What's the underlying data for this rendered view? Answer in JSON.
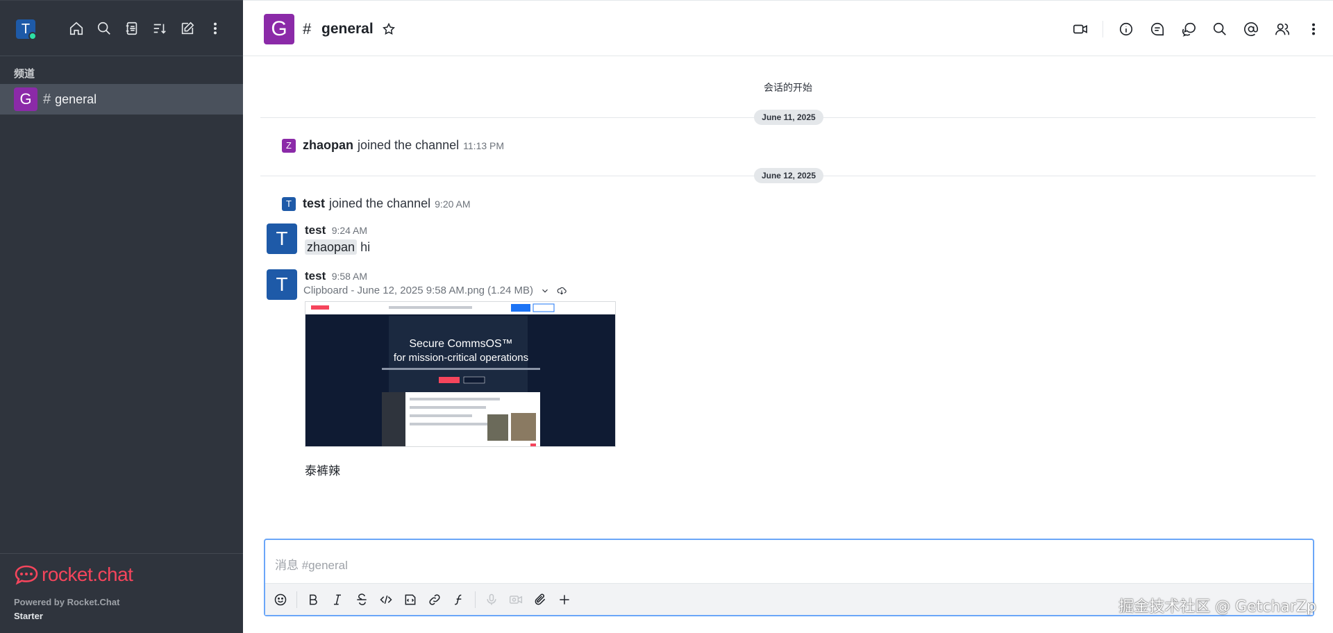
{
  "sidebar": {
    "user_avatar_letter": "T",
    "section_title": "频道",
    "channels": [
      {
        "avatar_letter": "G",
        "hash": "#",
        "name": "general",
        "selected": true
      }
    ],
    "footer": {
      "logo_text": "rocket.chat",
      "powered_by": "Powered by Rocket.Chat",
      "plan": "Starter"
    },
    "icons": [
      "home-icon",
      "search-icon",
      "directory-icon",
      "sort-icon",
      "create-new-icon",
      "kebab-menu-icon"
    ]
  },
  "header": {
    "avatar_letter": "G",
    "hash": "#",
    "title": "general",
    "actions": [
      "video-call-icon",
      "room-info-icon",
      "threads-icon",
      "discussions-icon",
      "search-messages-icon",
      "mentions-icon",
      "members-icon",
      "kebab-menu-icon"
    ]
  },
  "messages": {
    "conversation_start": "会话的开始",
    "date_1": "June 11, 2025",
    "date_2": "June 12, 2025",
    "system_1": {
      "avatar_letter": "Z",
      "user": "zhaopan",
      "text": "joined the channel",
      "time": "11:13 PM"
    },
    "system_2": {
      "avatar_letter": "T",
      "user": "test",
      "text": "joined the channel",
      "time": "9:20 AM"
    },
    "msg_1": {
      "avatar_letter": "T",
      "user": "test",
      "time": "9:24 AM",
      "mention": "zhaopan",
      "text": "hi"
    },
    "msg_2": {
      "avatar_letter": "T",
      "user": "test",
      "time": "9:58 AM",
      "file_name": "Clipboard - June 12, 2025 9:58 AM.png (1.24 MB)",
      "image_headline_1": "Secure CommsOS™",
      "image_headline_2": "for mission-critical operations",
      "caption": "泰裤辣"
    }
  },
  "composer": {
    "placeholder": "消息 #general",
    "toolbar": [
      "emoji-icon",
      "bold-icon",
      "italic-icon",
      "strikethrough-icon",
      "inline-code-icon",
      "code-block-icon",
      "link-icon",
      "katex-icon",
      "microphone-icon",
      "video-message-icon",
      "attach-icon",
      "plus-icon"
    ]
  },
  "watermark": "掘金技术社区 @ GetcharZp",
  "colors": {
    "sidebar_bg": "#2f343d",
    "channel_avatar": "#8b2aa8",
    "user_avatar": "#1e5aa8",
    "brand_red": "#f5455c",
    "composer_border": "#6aa6f8"
  }
}
